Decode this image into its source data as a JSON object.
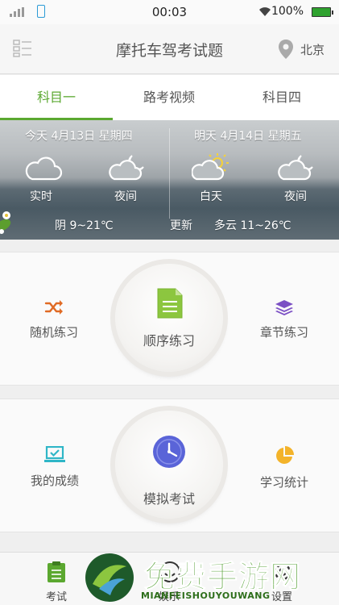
{
  "status": {
    "time": "00:03",
    "battery": "100%"
  },
  "header": {
    "title": "摩托车驾考试题",
    "city": "北京"
  },
  "tabs": [
    {
      "label": "科目一",
      "active": true
    },
    {
      "label": "路考视频",
      "active": false
    },
    {
      "label": "科目四",
      "active": false
    }
  ],
  "weather": {
    "today": {
      "date": "今天 4月13日 星期四",
      "now_label": "实时",
      "night_label": "夜间",
      "summary": "阴 9~21℃"
    },
    "tomorrow": {
      "date": "明天 4月14日 星期五",
      "day_label": "白天",
      "night_label": "夜间",
      "summary": "多云 11~26℃"
    },
    "update_label": "更新"
  },
  "practice": {
    "random": {
      "label": "随机练习",
      "icon": "shuffle-icon"
    },
    "sequential": {
      "label": "顺序练习",
      "icon": "document-icon"
    },
    "chapter": {
      "label": "章节练习",
      "icon": "layers-icon"
    }
  },
  "exam": {
    "scores": {
      "label": "我的成绩",
      "icon": "laptop-check-icon"
    },
    "mock": {
      "label": "模拟考试",
      "icon": "clock-icon"
    },
    "stats": {
      "label": "学习统计",
      "icon": "pie-chart-icon"
    }
  },
  "bottom_nav": [
    {
      "label": "考试",
      "icon": "clipboard-icon"
    },
    {
      "label": "娱乐",
      "icon": "smile-icon"
    },
    {
      "label": "设置",
      "icon": "gear-icon"
    }
  ],
  "watermark": {
    "title": "免费手游网",
    "subtitle": "MIANFEISHOUYOUWANG"
  },
  "colors": {
    "accent": "#5ba830",
    "shuffle": "#e06a24",
    "layers": "#7b4fc4",
    "document": "#8cc63f",
    "clock": "#5a64d8",
    "pie": "#f3b32a",
    "laptop": "#2fb6c7"
  }
}
